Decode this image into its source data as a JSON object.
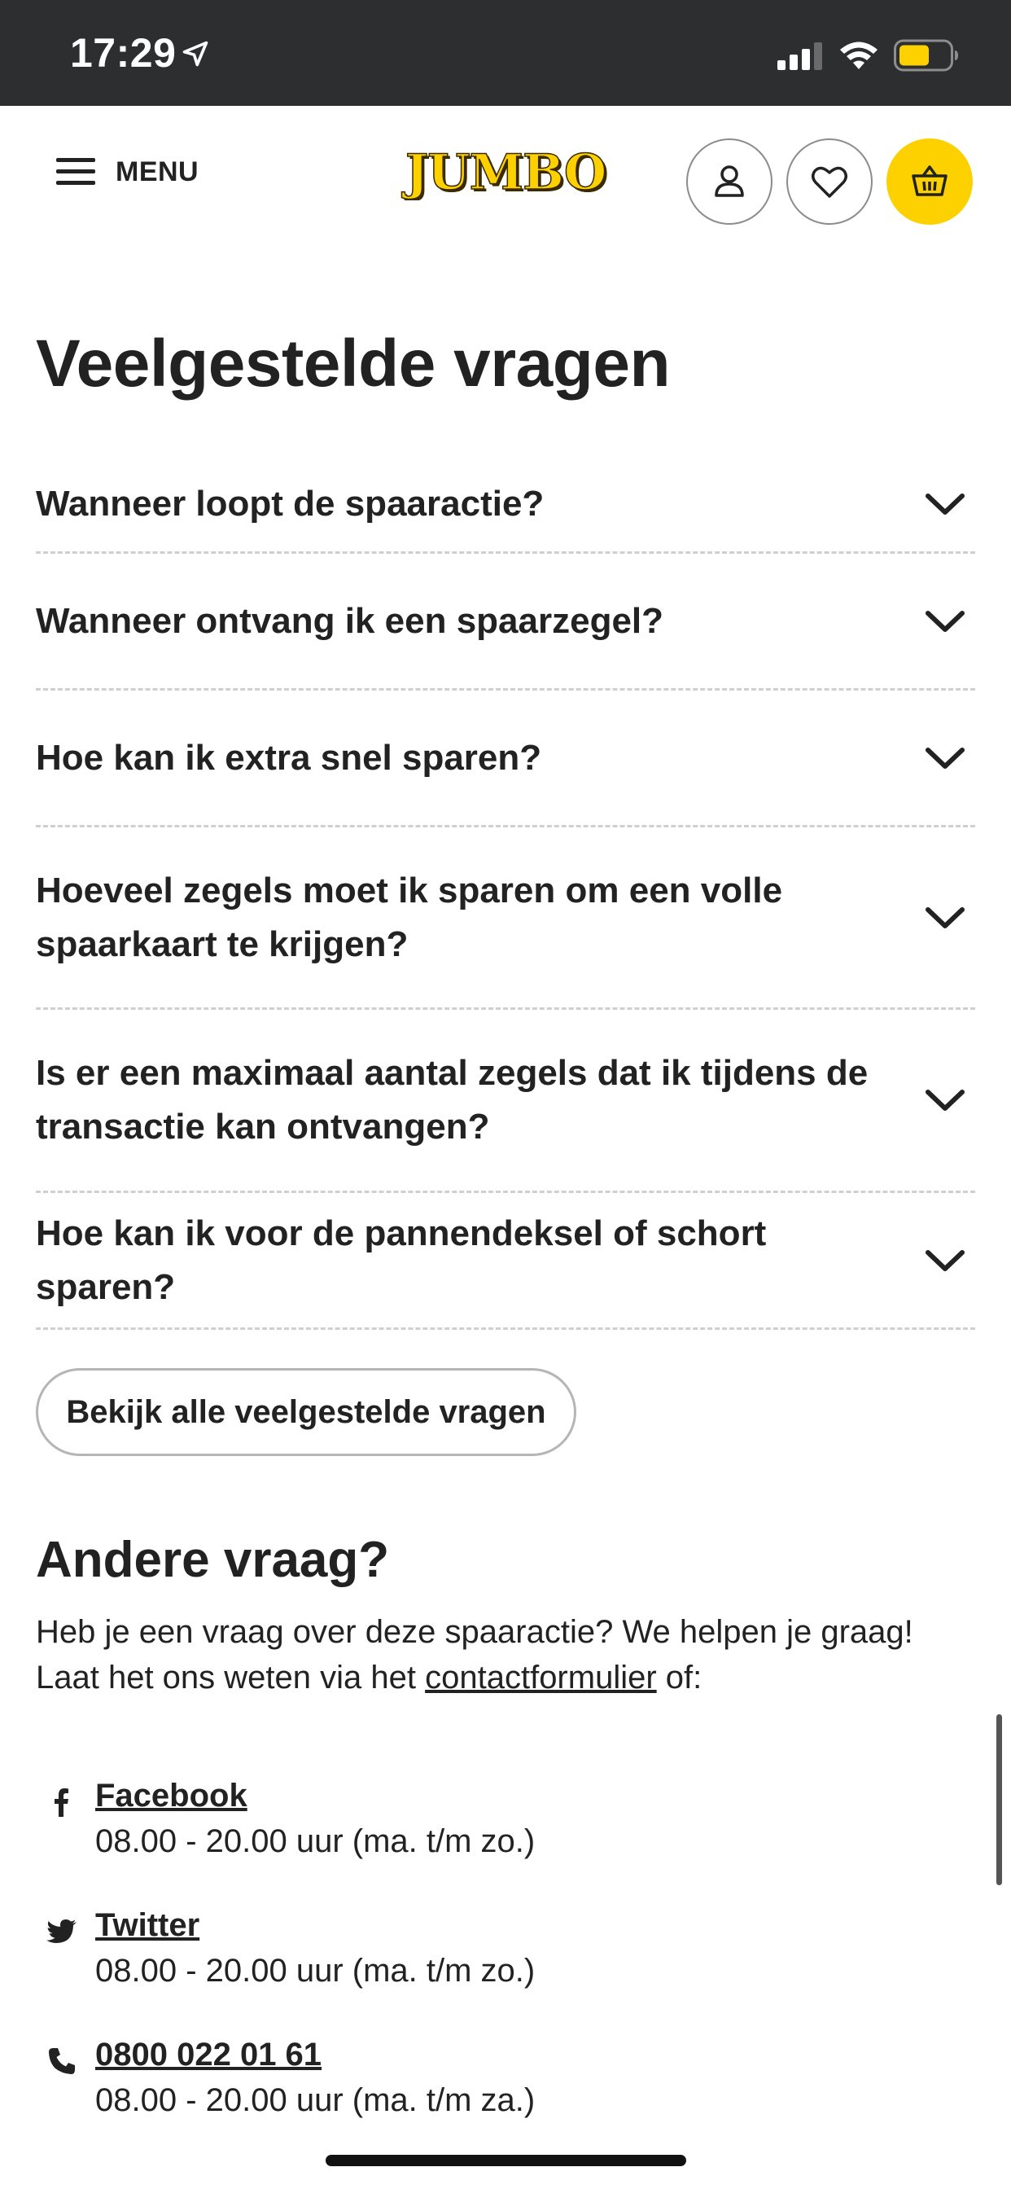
{
  "status_bar": {
    "time": "17:29",
    "battery_color": "#fdd100"
  },
  "header": {
    "menu_label": "MENU",
    "logo_text": "JUMBO",
    "brand_color": "#fdd100",
    "icons": [
      "menu-icon",
      "account-icon",
      "heart-icon",
      "basket-icon"
    ]
  },
  "faq": {
    "title": "Veelgestelde vragen",
    "questions": [
      "Wanneer loopt de spaaractie?",
      "Wanneer ontvang ik een spaarzegel?",
      "Hoe kan ik extra snel sparen?",
      "Hoeveel zegels moet ik sparen om een volle spaarkaart te krijgen?",
      "Is er een maximaal aantal zegels dat ik tijdens de transactie kan ontvangen?",
      "Hoe kan ik voor de pannendeksel of schort sparen?"
    ],
    "all_button": "Bekijk alle veelgestelde vragen"
  },
  "other": {
    "title_bold": "Andere",
    "title_rest": " vraag?",
    "line1": "Heb je een vraag over deze spaaractie? We helpen je graag!",
    "line2_pre": "Laat het ons weten via het ",
    "line2_link": "contactformulier",
    "line2_post": " of:",
    "contacts": [
      {
        "icon": "facebook-icon",
        "label": "Facebook",
        "hours": "08.00 - 20.00 uur (ma. t/m zo.)"
      },
      {
        "icon": "twitter-icon",
        "label": "Twitter",
        "hours": "08.00 - 20.00 uur (ma. t/m zo.)"
      },
      {
        "icon": "phone-icon",
        "label": "0800 022 01 61",
        "hours": "08.00 - 20.00 uur (ma. t/m za.)"
      }
    ]
  }
}
